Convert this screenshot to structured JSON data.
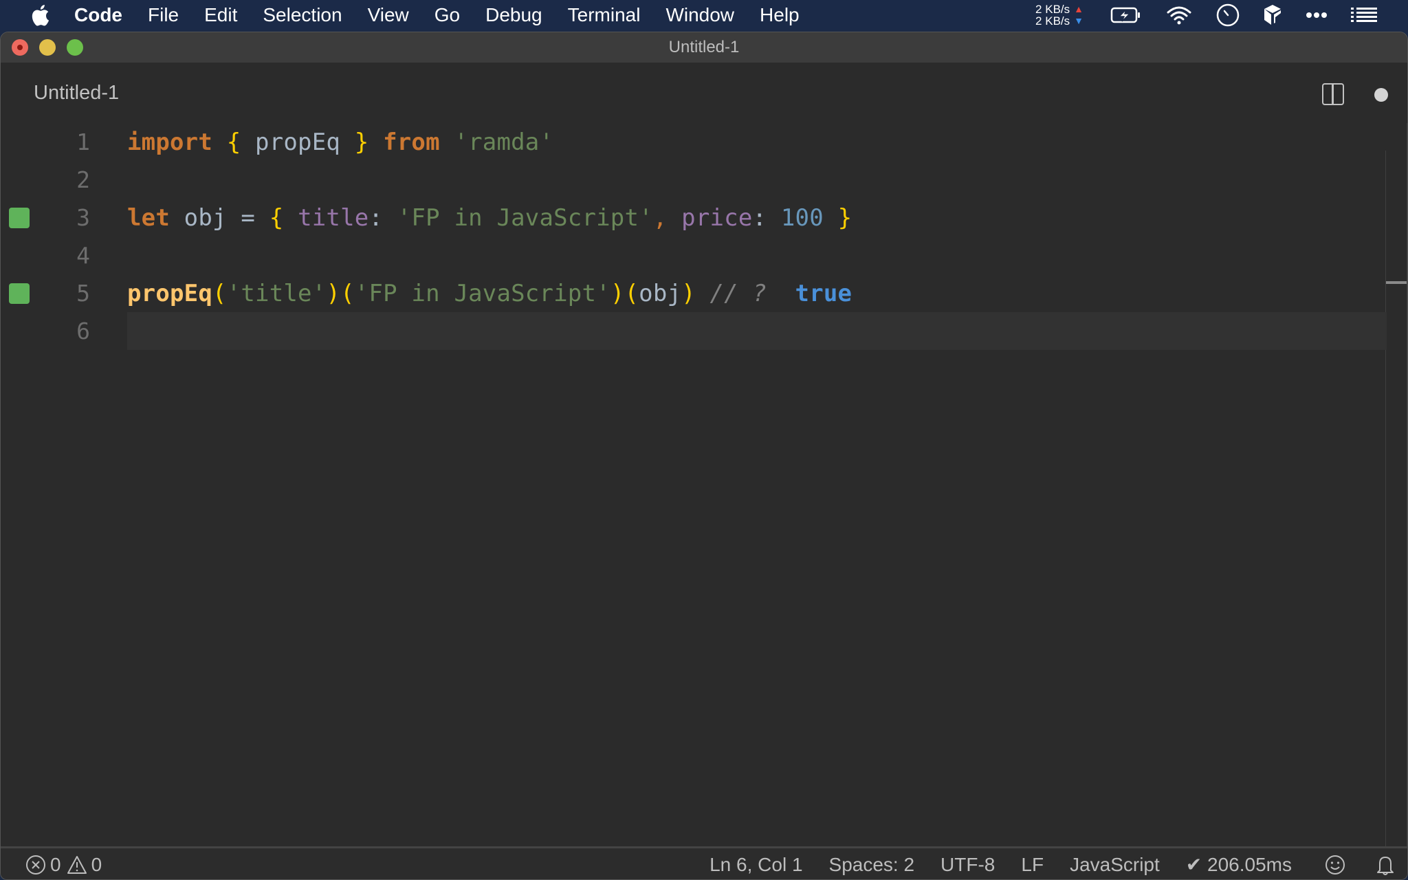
{
  "menubar": {
    "apple_icon": "apple-logo-icon",
    "items": [
      "Code",
      "File",
      "Edit",
      "Selection",
      "View",
      "Go",
      "Debug",
      "Terminal",
      "Window",
      "Help"
    ],
    "net_up": "2 KB/s",
    "net_down": "2 KB/s",
    "tray_icons": [
      "battery-charging-icon",
      "wifi-icon",
      "clock-icon",
      "box-icon",
      "more-icon",
      "list-icon"
    ]
  },
  "window": {
    "title": "Untitled-1",
    "controls": [
      "close",
      "minimize",
      "maximize"
    ]
  },
  "tabbar": {
    "tab_label": "Untitled-1",
    "split_editor_icon": "split-editor-icon",
    "dirty_indicator": "unsaved-dot-icon"
  },
  "editor": {
    "lines": [
      {
        "number": "1",
        "marker": false,
        "tokens": [
          {
            "t": "import",
            "c": "kw"
          },
          {
            "t": " ",
            "c": "ident"
          },
          {
            "t": "{",
            "c": "brace"
          },
          {
            "t": " propEq ",
            "c": "ident"
          },
          {
            "t": "}",
            "c": "brace"
          },
          {
            "t": " ",
            "c": "ident"
          },
          {
            "t": "from",
            "c": "kw"
          },
          {
            "t": " ",
            "c": "ident"
          },
          {
            "t": "'ramda'",
            "c": "str"
          }
        ]
      },
      {
        "number": "2",
        "marker": false,
        "tokens": []
      },
      {
        "number": "3",
        "marker": true,
        "tokens": [
          {
            "t": "let",
            "c": "kw"
          },
          {
            "t": " obj = ",
            "c": "ident"
          },
          {
            "t": "{",
            "c": "brace"
          },
          {
            "t": " ",
            "c": "ident"
          },
          {
            "t": "title",
            "c": "prop"
          },
          {
            "t": ": ",
            "c": "punc"
          },
          {
            "t": "'FP in JavaScript'",
            "c": "str"
          },
          {
            "t": ",",
            "c": "comma"
          },
          {
            "t": " ",
            "c": "ident"
          },
          {
            "t": "price",
            "c": "prop"
          },
          {
            "t": ": ",
            "c": "punc"
          },
          {
            "t": "100",
            "c": "num"
          },
          {
            "t": " ",
            "c": "ident"
          },
          {
            "t": "}",
            "c": "brace"
          }
        ]
      },
      {
        "number": "4",
        "marker": false,
        "tokens": []
      },
      {
        "number": "5",
        "marker": true,
        "tokens": [
          {
            "t": "propEq",
            "c": "fn"
          },
          {
            "t": "(",
            "c": "brace"
          },
          {
            "t": "'title'",
            "c": "str"
          },
          {
            "t": ")",
            "c": "brace"
          },
          {
            "t": "(",
            "c": "brace"
          },
          {
            "t": "'FP in JavaScript'",
            "c": "str"
          },
          {
            "t": ")",
            "c": "brace"
          },
          {
            "t": "(",
            "c": "brace"
          },
          {
            "t": "obj",
            "c": "ident"
          },
          {
            "t": ")",
            "c": "brace"
          },
          {
            "t": " ",
            "c": "ident"
          },
          {
            "t": "// ?",
            "c": "comment"
          },
          {
            "t": "  ",
            "c": "ident"
          },
          {
            "t": "true",
            "c": "result"
          }
        ]
      },
      {
        "number": "6",
        "marker": false,
        "current": true,
        "tokens": []
      }
    ],
    "colors": {
      "keyword": "#cc7832",
      "brace": "#ffd000",
      "identifier": "#a9b7c6",
      "string": "#6a8759",
      "property": "#9876aa",
      "number": "#6897bb",
      "function": "#ffc66d",
      "comment": "#808080",
      "inline_result": "#4a90d9",
      "coverage_marker": "#5fb35a"
    }
  },
  "statusbar": {
    "errors": "0",
    "warnings": "0",
    "cursor": "Ln 6, Col 1",
    "indent": "Spaces: 2",
    "encoding": "UTF-8",
    "eol": "LF",
    "language": "JavaScript",
    "timing": "✔ 206.05ms"
  }
}
